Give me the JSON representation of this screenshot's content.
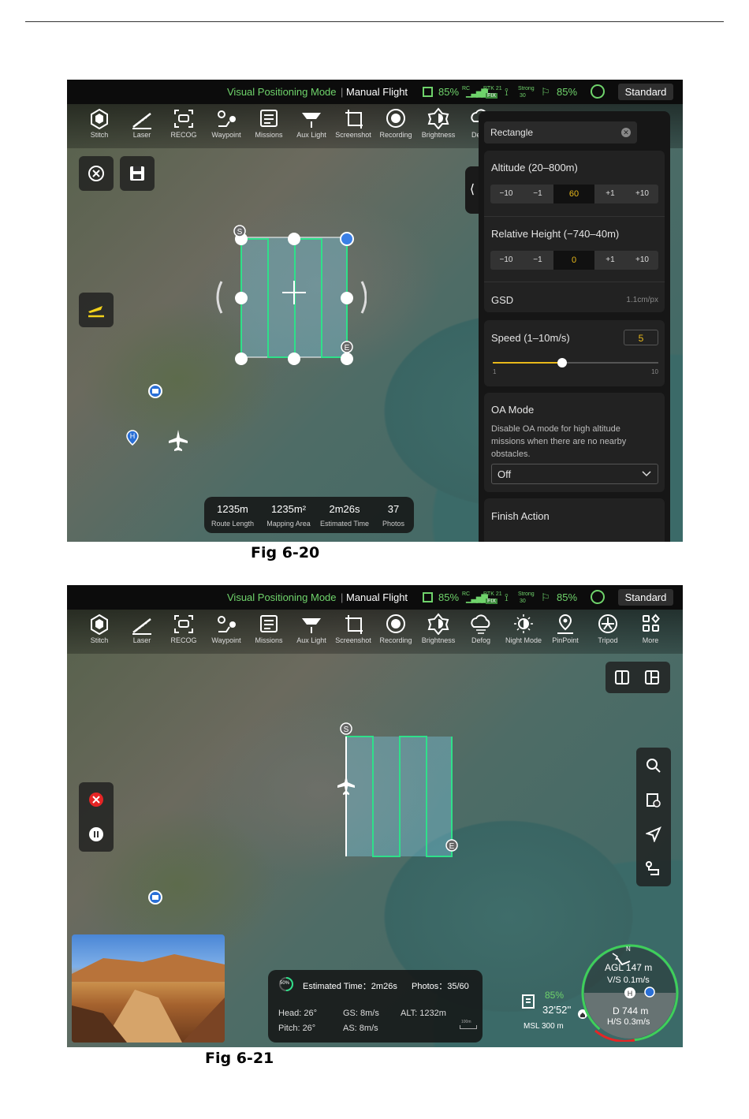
{
  "status": {
    "mode": "Visual Positioning Mode",
    "flight": "Manual Flight",
    "battery": "85%",
    "rc": "RC",
    "rtk": "RTK 21",
    "fix": "FIX",
    "signal": "Strong",
    "signal_num": "30",
    "rc_battery": "85%",
    "profile": "Standard"
  },
  "toolbar": [
    "Stitch",
    "Laser",
    "RECOG",
    "Waypoint",
    "Missions",
    "Aux Light",
    "Screenshot",
    "Recording",
    "Brightness",
    "Defog",
    "Night Mode",
    "PinPoint",
    "Tripod",
    "More"
  ],
  "fig1": {
    "caption": "Fig 6-20",
    "panel": {
      "shape": "Rectangle",
      "altitude_label": "Altitude (20–800m)",
      "altitude_steps": [
        "−10",
        "−1",
        "60",
        "+1",
        "+10"
      ],
      "rel_label": "Relative Height (−740–40m)",
      "rel_steps": [
        "−10",
        "−1",
        "0",
        "+1",
        "+10"
      ],
      "gsd_label": "GSD",
      "gsd_value": "1.1cm/px",
      "speed_label": "Speed (1–10m/s)",
      "speed_value": "5",
      "speed_min": "1",
      "speed_max": "10",
      "speed_fraction": 0.42,
      "oa_title": "OA Mode",
      "oa_desc": "Disable OA mode for high altitude missions when there are no nearby obstacles.",
      "oa_value": "Off",
      "finish_label": "Finish Action"
    },
    "stats": [
      {
        "value": "1235m",
        "label": "Route Length"
      },
      {
        "value": "1235m²",
        "label": "Mapping Area"
      },
      {
        "value": "2m26s",
        "label": "Estimated Time"
      },
      {
        "value": "37",
        "label": "Photos"
      }
    ]
  },
  "fig2": {
    "caption": "Fig 6-21",
    "progress": "50%",
    "estimated_time": "Estimated Time：2m26s",
    "photos": "Photos：35/60",
    "head": "Head: 26°",
    "pitch": "Pitch: 26°",
    "gs": "GS: 8m/s",
    "as": "AS: 8m/s",
    "alt": "ALT: 1232m",
    "scale": "100m",
    "battery_pct": "85%",
    "flight_time": "32'52''",
    "msl": "MSL 300 m",
    "agl": "AGL 147 m",
    "vs": "V/S 0.1m/s",
    "dist": "D 744 m",
    "hs": "H/S 0.3m/s",
    "north": "N"
  },
  "colors": {
    "accent_green": "#6fd36b",
    "route": "#2fe08a",
    "value_yellow": "#e8b81a"
  }
}
